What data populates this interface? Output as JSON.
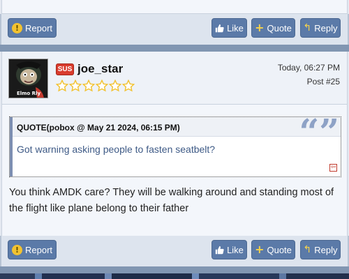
{
  "actions": {
    "report_label": "Report",
    "like_label": "Like",
    "quote_label": "Quote",
    "reply_label": "Reply",
    "icons": {
      "report": "exclamation-circle-icon",
      "like": "thumbs-up-icon",
      "quote": "plus-icon",
      "reply": "reply-arrow-icon"
    }
  },
  "post": {
    "badge": "SUS",
    "avatar_caption": "Elmo Rly",
    "username": "joe_star",
    "rating_stars": 6,
    "rating_filled": 0,
    "timestamp": "Today, 06:27 PM",
    "post_number": "Post #25",
    "quote": {
      "author_line": "QUOTE(pobox @ May 21 2024, 06:15 PM)",
      "text": "Got warning asking people to fasten seatbelt?"
    },
    "body": "You think AMDK care? They will be walking around and standing most of the flight like plane belong to their father"
  },
  "colors": {
    "button": "#5b7aa8",
    "divider": "#8196b2",
    "badge": "#d93c2e",
    "quote_text": "#3e5a86",
    "star": "#f2c230"
  }
}
